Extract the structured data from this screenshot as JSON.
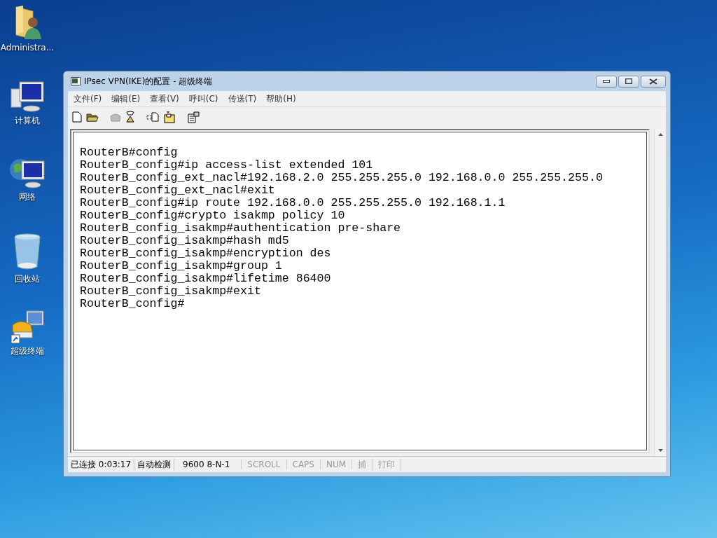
{
  "desktop_icons": [
    {
      "label": "Administra...",
      "kind": "user-folder"
    },
    {
      "label": "计算机",
      "kind": "computer"
    },
    {
      "label": "网络",
      "kind": "network"
    },
    {
      "label": "回收站",
      "kind": "recycle-bin"
    },
    {
      "label": "超级终端",
      "kind": "terminal"
    }
  ],
  "window": {
    "title": "IPsec VPN(IKE)的配置 - 超级终端"
  },
  "menu": [
    "文件(F)",
    "编辑(E)",
    "查看(V)",
    "呼叫(C)",
    "传送(T)",
    "帮助(H)"
  ],
  "terminal_lines": [
    "RouterB#config",
    "RouterB_config#ip access-list extended 101",
    "RouterB_config_ext_nacl#192.168.2.0 255.255.255.0 192.168.0.0 255.255.255.0",
    "RouterB_config_ext_nacl#exit",
    "RouterB_config#ip route 192.168.0.0 255.255.255.0 192.168.1.1",
    "RouterB_config#crypto isakmp policy 10",
    "RouterB_config_isakmp#authentication pre-share",
    "RouterB_config_isakmp#hash md5",
    "RouterB_config_isakmp#encryption des",
    "RouterB_config_isakmp#group 1",
    "RouterB_config_isakmp#lifetime 86400",
    "RouterB_config_isakmp#exit",
    "RouterB_config#"
  ],
  "status_bar": [
    {
      "text": "已连接 0:03:17",
      "on": true
    },
    {
      "text": "自动检测",
      "on": true
    },
    {
      "text": "9600 8-N-1",
      "on": true
    },
    {
      "text": "SCROLL",
      "on": false
    },
    {
      "text": "CAPS",
      "on": false
    },
    {
      "text": "NUM",
      "on": false
    },
    {
      "text": "捕",
      "on": false
    },
    {
      "text": "打印",
      "on": false
    }
  ]
}
